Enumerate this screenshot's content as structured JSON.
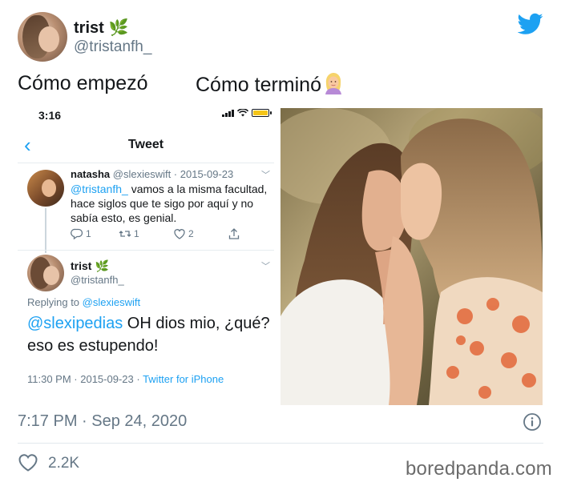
{
  "author": {
    "name": "trist",
    "emoji": "🌿",
    "handle": "@tristanfh_"
  },
  "captions": {
    "left": "Cómo empezó",
    "right": "Cómo terminó"
  },
  "screenshot": {
    "status_time": "3:16",
    "nav_title": "Tweet",
    "tweet1": {
      "name": "natasha",
      "meta": "@slexieswift · 2015-09-23",
      "mention": "@tristanfh_",
      "text": " vamos a la misma facultad, hace siglos que te sigo por aquí y no sabía esto, es genial.",
      "replies": "1",
      "retweets": "1",
      "likes": "2"
    },
    "tweet2": {
      "name": "trist",
      "emoji": "🌿",
      "handle": "@tristanfh_",
      "replying_label": "Replying to ",
      "replying_handle": "@slexieswift",
      "mention": "@slexipedias",
      "text": " OH dios mio, ¿qué? eso es estupendo!",
      "timestamp": "11:30 PM · 2015-09-23 · ",
      "source": "Twitter for iPhone"
    }
  },
  "footer": {
    "timestamp": "7:17 PM · Sep 24, 2020",
    "likes": "2.2K"
  },
  "watermark": "boredpanda.com",
  "colors": {
    "twitter_blue": "#1da1f2",
    "secondary_text": "#657786",
    "primary_text": "#14171a"
  },
  "icons": [
    "twitter-bird-icon",
    "chevron-left-icon",
    "reply-icon",
    "retweet-icon",
    "heart-icon",
    "share-icon",
    "info-icon",
    "woman-emoji-icon"
  ]
}
